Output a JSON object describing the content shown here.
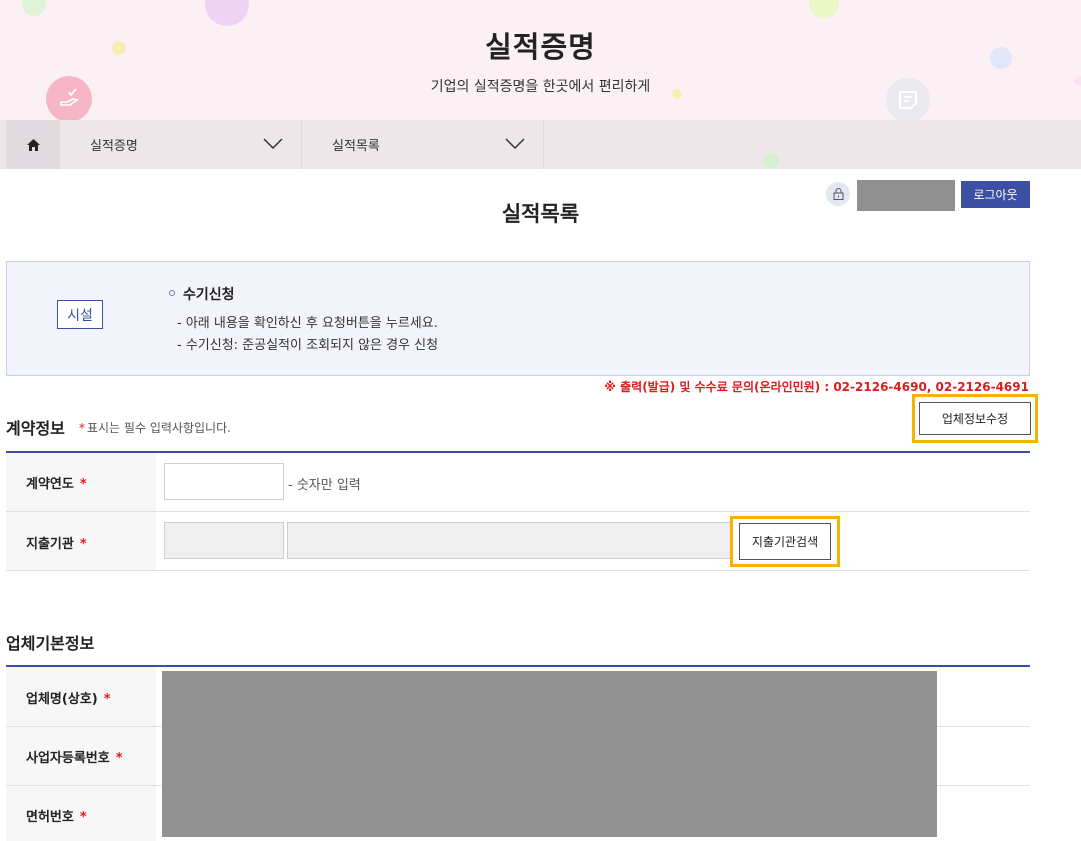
{
  "header": {
    "title": "실적증명",
    "subtitle": "기업의 실적증명을 한곳에서 편리하게"
  },
  "nav": {
    "home_icon": "home-icon",
    "items": [
      {
        "label": "실적증명"
      },
      {
        "label": "실적목록"
      }
    ]
  },
  "login": {
    "logout_label": "로그아웃"
  },
  "page": {
    "title": "실적목록"
  },
  "info": {
    "category": "시설",
    "heading": "수기신청",
    "lines": [
      "- 아래 내용을 확인하신 후 요청버튼을 누르세요.",
      "- 수기신청: 준공실적이 조회되지 않은 경우 신청"
    ],
    "contact": "※ 출력(발급) 및 수수료 문의(온라인민원) : 02-2126-4690, 02-2126-4691"
  },
  "contract": {
    "title": "계약정보",
    "required_note": "표시는 필수 입력사항입니다.",
    "required_mark": "*",
    "edit_company_label": "업체정보수정",
    "rows": {
      "year": {
        "label": "계약연도",
        "value": "",
        "hint": "- 숫자만 입력"
      },
      "org": {
        "label": "지출기관",
        "code_value": "",
        "name_value": "",
        "search_label": "지출기관검색"
      }
    }
  },
  "company": {
    "title": "업체기본정보",
    "rows": [
      {
        "label": "업체명(상호)"
      },
      {
        "label": "사업자등록번호"
      },
      {
        "label": "면허번호"
      }
    ]
  },
  "colors": {
    "accent": "#3b4fa3",
    "highlight": "#f4b400",
    "required": "#e01b1b"
  }
}
